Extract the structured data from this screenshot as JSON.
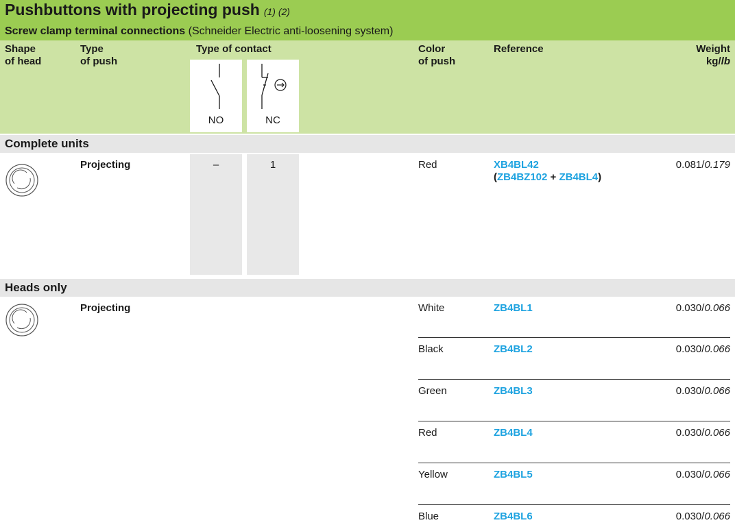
{
  "title": {
    "main": "Pushbuttons with projecting push",
    "notes": "(1) (2)",
    "subtitle_bold": "Screw clamp terminal connections",
    "subtitle_rest": " (Schneider Electric anti-loosening system)"
  },
  "headers": {
    "shape_line1": "Shape",
    "shape_line2": "of head",
    "type_line1": "Type",
    "type_line2": "of push",
    "contact": "Type of contact",
    "no": "NO",
    "nc": "NC",
    "color_line1": "Color",
    "color_line2": "of push",
    "reference": "Reference",
    "weight_line1": "Weight",
    "weight_kg": "kg/",
    "weight_lb": "lb"
  },
  "complete_units": {
    "section": "Complete units",
    "push_type": "Projecting",
    "no_value": "–",
    "nc_value": "1",
    "color": "Red",
    "reference": "XB4BL42",
    "composition_open": "(",
    "component_1": "ZB4BZ102",
    "plus": " + ",
    "component_2": "ZB4BL4",
    "composition_close": ")",
    "weight_kg": "0.081/",
    "weight_lb": "0.179"
  },
  "heads_only": {
    "section": "Heads only",
    "push_type": "Projecting",
    "rows": [
      {
        "color": "White",
        "reference": "ZB4BL1",
        "weight_kg": "0.030/",
        "weight_lb": "0.066"
      },
      {
        "color": "Black",
        "reference": "ZB4BL2",
        "weight_kg": "0.030/",
        "weight_lb": "0.066"
      },
      {
        "color": "Green",
        "reference": "ZB4BL3",
        "weight_kg": "0.030/",
        "weight_lb": "0.066"
      },
      {
        "color": "Red",
        "reference": "ZB4BL4",
        "weight_kg": "0.030/",
        "weight_lb": "0.066"
      },
      {
        "color": "Yellow",
        "reference": "ZB4BL5",
        "weight_kg": "0.030/",
        "weight_lb": "0.066"
      },
      {
        "color": "Blue",
        "reference": "ZB4BL6",
        "weight_kg": "0.030/",
        "weight_lb": "0.066"
      }
    ]
  },
  "colors": {
    "title_band": "#9bcc52",
    "header_band": "#cde3a4",
    "section_band": "#e6e6e6",
    "contact_column": "#e8e8e8",
    "reference_link": "#1ea3e0"
  },
  "icons": [
    "no-contact-symbol-icon",
    "nc-contact-symbol-icon",
    "positive-opening-icon",
    "round-head-icon"
  ]
}
